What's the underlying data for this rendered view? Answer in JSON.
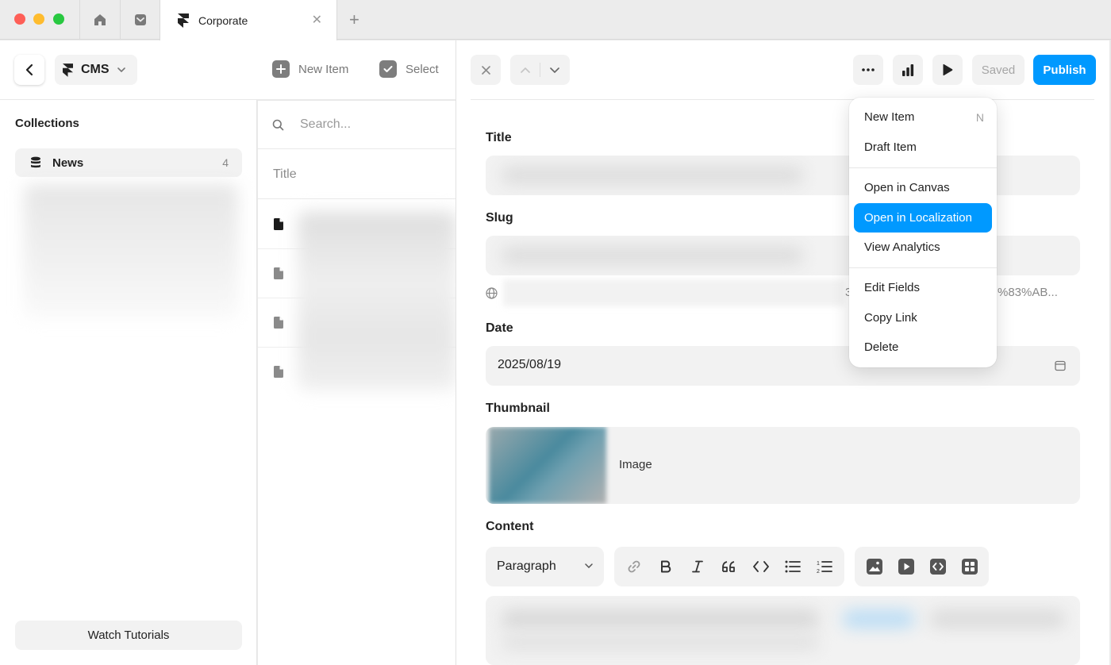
{
  "window": {
    "tab_title": "Corporate"
  },
  "topbar": {
    "cms_label": "CMS",
    "new_item_label": "New Item",
    "select_label": "Select"
  },
  "sidebar": {
    "heading": "Collections",
    "collections": [
      {
        "label": "News",
        "count": "4"
      }
    ],
    "watch_tutorials_label": "Watch Tutorials"
  },
  "list": {
    "search_placeholder": "Search...",
    "column_title": "Title"
  },
  "editor": {
    "saved_label": "Saved",
    "publish_label": "Publish",
    "fields": {
      "title_label": "Title",
      "slug_label": "Slug",
      "slug_url_partial_left": "3",
      "slug_url_partial_right": "%83%AB...",
      "date_label": "Date",
      "date_value": "2025/08/19",
      "thumbnail_label": "Thumbnail",
      "thumbnail_image_label": "Image",
      "content_label": "Content",
      "paragraph_select": "Paragraph"
    }
  },
  "menu": {
    "groups": [
      [
        {
          "label": "New Item",
          "shortcut": "N"
        },
        {
          "label": "Draft Item"
        }
      ],
      [
        {
          "label": "Open in Canvas"
        },
        {
          "label": "Open in Localization",
          "highlighted": true
        },
        {
          "label": "View Analytics"
        }
      ],
      [
        {
          "label": "Edit Fields"
        },
        {
          "label": "Copy Link"
        },
        {
          "label": "Delete"
        }
      ]
    ]
  },
  "colors": {
    "accent": "#0099ff",
    "traffic_red": "#fe5f57",
    "traffic_yellow": "#febc2e",
    "traffic_green": "#28c840"
  }
}
